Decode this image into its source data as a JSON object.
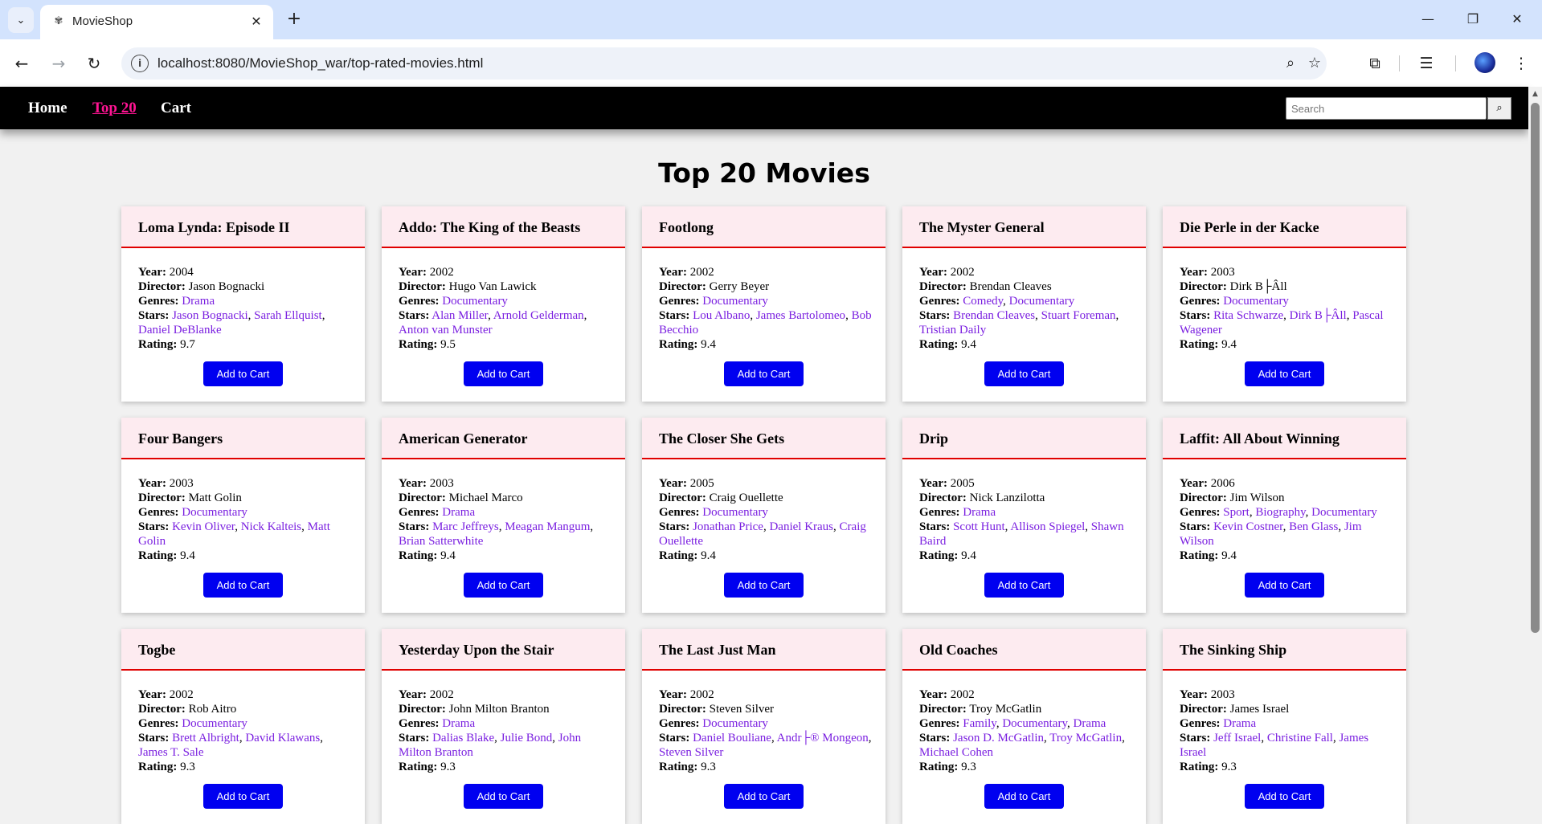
{
  "browser": {
    "tab_title": "MovieShop",
    "url": "localhost:8080/MovieShop_war/top-rated-movies.html"
  },
  "site_nav": {
    "links": [
      {
        "label": "Home",
        "active": false
      },
      {
        "label": "Top 20",
        "active": true
      },
      {
        "label": "Cart",
        "active": false
      }
    ],
    "search_placeholder": "Search",
    "search_button_icon": "search-icon"
  },
  "page": {
    "title": "Top 20 Movies",
    "add_to_cart_label": "Add to Cart",
    "labels": {
      "year": "Year:",
      "director": "Director:",
      "genres": "Genres:",
      "stars": "Stars:",
      "rating": "Rating:"
    }
  },
  "movies": [
    {
      "title": "Loma Lynda: Episode II",
      "year": "2004",
      "director": "Jason Bognacki",
      "genres": [
        "Drama"
      ],
      "stars": [
        "Jason Bognacki",
        "Sarah Ellquist",
        "Daniel DeBlanke"
      ],
      "rating": "9.7"
    },
    {
      "title": "Addo: The King of the Beasts",
      "year": "2002",
      "director": "Hugo Van Lawick",
      "genres": [
        "Documentary"
      ],
      "stars": [
        "Alan Miller",
        "Arnold Gelderman",
        "Anton van Munster"
      ],
      "rating": "9.5"
    },
    {
      "title": "Footlong",
      "year": "2002",
      "director": "Gerry Beyer",
      "genres": [
        "Documentary"
      ],
      "stars": [
        "Lou Albano",
        "James Bartolomeo",
        "Bob Becchio"
      ],
      "rating": "9.4"
    },
    {
      "title": "The Myster General",
      "year": "2002",
      "director": "Brendan Cleaves",
      "genres": [
        "Comedy",
        "Documentary"
      ],
      "stars": [
        "Brendan Cleaves",
        "Stuart Foreman",
        "Tristian Daily"
      ],
      "rating": "9.4"
    },
    {
      "title": "Die Perle in der Kacke",
      "year": "2003",
      "director": "Dirk B├Âll",
      "genres": [
        "Documentary"
      ],
      "stars": [
        "Rita Schwarze",
        "Dirk B├Âll",
        "Pascal Wagener"
      ],
      "rating": "9.4"
    },
    {
      "title": "Four Bangers",
      "year": "2003",
      "director": "Matt Golin",
      "genres": [
        "Documentary"
      ],
      "stars": [
        "Kevin Oliver",
        "Nick Kalteis",
        "Matt Golin"
      ],
      "rating": "9.4"
    },
    {
      "title": "American Generator",
      "year": "2003",
      "director": "Michael Marco",
      "genres": [
        "Drama"
      ],
      "stars": [
        "Marc Jeffreys",
        "Meagan Mangum",
        "Brian Satterwhite"
      ],
      "rating": "9.4"
    },
    {
      "title": "The Closer She Gets",
      "year": "2005",
      "director": "Craig Ouellette",
      "genres": [
        "Documentary"
      ],
      "stars": [
        "Jonathan Price",
        "Daniel Kraus",
        "Craig Ouellette"
      ],
      "rating": "9.4"
    },
    {
      "title": "Drip",
      "year": "2005",
      "director": "Nick Lanzilotta",
      "genres": [
        "Drama"
      ],
      "stars": [
        "Scott Hunt",
        "Allison Spiegel",
        "Shawn Baird"
      ],
      "rating": "9.4"
    },
    {
      "title": "Laffit: All About Winning",
      "year": "2006",
      "director": "Jim Wilson",
      "genres": [
        "Sport",
        "Biography",
        "Documentary"
      ],
      "stars": [
        "Kevin Costner",
        "Ben Glass",
        "Jim Wilson"
      ],
      "rating": "9.4"
    },
    {
      "title": "Togbe",
      "year": "2002",
      "director": "Rob Aitro",
      "genres": [
        "Documentary"
      ],
      "stars": [
        "Brett Albright",
        "David Klawans",
        "James T. Sale"
      ],
      "rating": "9.3"
    },
    {
      "title": "Yesterday Upon the Stair",
      "year": "2002",
      "director": "John Milton Branton",
      "genres": [
        "Drama"
      ],
      "stars": [
        "Dalias Blake",
        "Julie Bond",
        "John Milton Branton"
      ],
      "rating": "9.3"
    },
    {
      "title": "The Last Just Man",
      "year": "2002",
      "director": "Steven Silver",
      "genres": [
        "Documentary"
      ],
      "stars": [
        "Daniel Bouliane",
        "Andr├® Mongeon",
        "Steven Silver"
      ],
      "rating": "9.3"
    },
    {
      "title": "Old Coaches",
      "year": "2002",
      "director": "Troy McGatlin",
      "genres": [
        "Family",
        "Documentary",
        "Drama"
      ],
      "stars": [
        "Jason D. McGatlin",
        "Troy McGatlin",
        "Michael Cohen"
      ],
      "rating": "9.3"
    },
    {
      "title": "The Sinking Ship",
      "year": "2003",
      "director": "James Israel",
      "genres": [
        "Drama"
      ],
      "stars": [
        "Jeff Israel",
        "Christine Fall",
        "James Israel"
      ],
      "rating": "9.3"
    }
  ],
  "colors": {
    "nav_bg": "#000000",
    "active_link": "#ff1493",
    "card_header": "#fdebf0",
    "card_rule": "#e00000",
    "button": "#0000f0",
    "link": "#7a1fe0"
  }
}
